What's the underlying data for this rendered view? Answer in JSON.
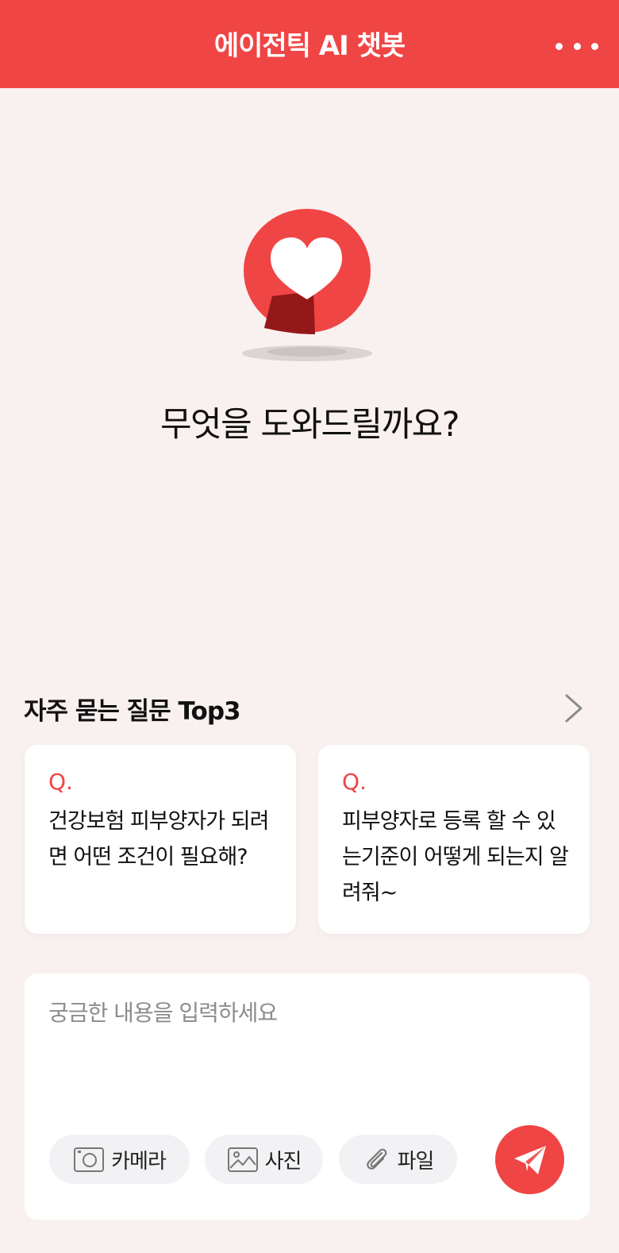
{
  "header": {
    "title": "에이전틱 AI 챗봇",
    "more_icon": "more-horizontal-icon"
  },
  "hero": {
    "mascot_icon": "heart-chat-bubble-logo",
    "greeting": "무엇을 도와드릴까요?"
  },
  "faq": {
    "title": "자주 묻는 질문 Top3",
    "more_icon": "chevron-right-icon",
    "cards": [
      {
        "q_label": "Q.",
        "text": "건강보험 피부양자가 되려면 어떤 조건이 필요해?"
      },
      {
        "q_label": "Q.",
        "text": "피부양자로 등록 할 수 있는기준이 어떻게 되는지 알려줘~"
      }
    ]
  },
  "composer": {
    "placeholder": "궁금한 내용을 입력하세요",
    "value": "",
    "buttons": {
      "camera": {
        "label": "카메라",
        "icon": "camera-icon"
      },
      "photo": {
        "label": "사진",
        "icon": "image-icon"
      },
      "file": {
        "label": "파일",
        "icon": "paperclip-icon"
      }
    },
    "send_icon": "paper-plane-icon"
  },
  "colors": {
    "accent": "#f04545",
    "background": "#f9f1f0",
    "card": "#ffffff",
    "chip": "#f2f2f5"
  }
}
